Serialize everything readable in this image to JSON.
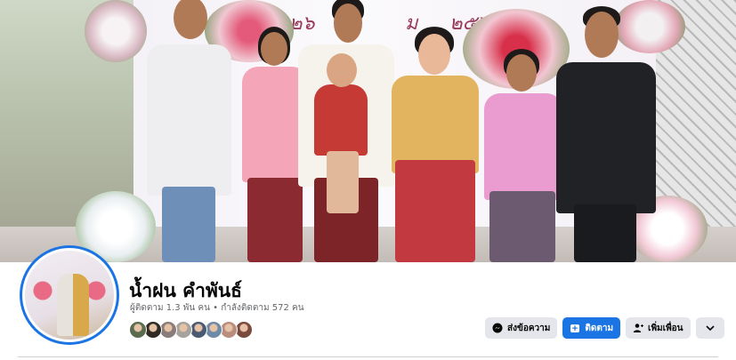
{
  "cover": {
    "sign_text_left": "๒๖",
    "sign_text_mid": "ม",
    "sign_text_right": "๒๕๖๔"
  },
  "profile": {
    "name": "น้ำฝน คำพันธ์",
    "followers": "ผู้ติดตาม 1.3 พัน คน",
    "separator": "•",
    "following": "กำลังติดตาม 572 คน"
  },
  "friends_preview": [
    {
      "color": "#5a6b4e"
    },
    {
      "color": "#2f2a24"
    },
    {
      "color": "#8a7c78"
    },
    {
      "color": "#a6a39c"
    },
    {
      "color": "#4a5a73"
    },
    {
      "color": "#6f8aa6"
    },
    {
      "color": "#b98e7e"
    },
    {
      "color": "#7a4a3f"
    }
  ],
  "actions": {
    "message_label": "ส่งข้อความ",
    "follow_label": "ติดตาม",
    "add_friend_label": "เพิ่มเพื่อน"
  },
  "colors": {
    "accent": "#1b74e4",
    "button_gray": "#e4e6eb",
    "secondary_text": "#65676b"
  }
}
